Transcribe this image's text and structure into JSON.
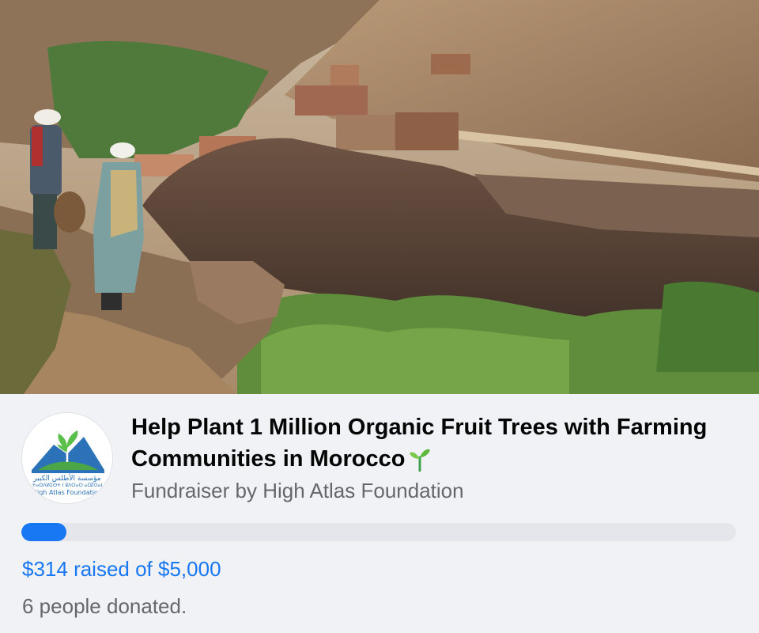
{
  "cover": {
    "image_icon": "photo-mountain-village"
  },
  "organization": {
    "logo_icon": "sprout-mountain-logo",
    "logo_arabic_text": "مؤسسة الأطلس الكبير",
    "logo_tifinagh_text": "ⵜⴰⵙⴷⵍⵉⵙⵜ ⵏ ⵓⴷⵔⴰⵔ ⴰⵎⵇⵔⴰⵏ",
    "logo_english_text": "High Atlas Foundation"
  },
  "fundraiser": {
    "title": "Help Plant 1 Million Organic Fruit Trees with Farming Communities in Morocco",
    "title_emoji_icon": "seedling-icon",
    "byline_prefix": "Fundraiser by ",
    "organizer": "High Atlas Foundation",
    "raised_text": "$314 raised of $5,000",
    "donors_text": "6 people donated.",
    "raised_amount": 314,
    "goal_amount": 5000,
    "progress_fraction": 0.0628
  },
  "colors": {
    "accent": "#1877f2",
    "secondary_text": "#65676b",
    "track": "#e4e6eb",
    "background": "#f0f2f5"
  }
}
